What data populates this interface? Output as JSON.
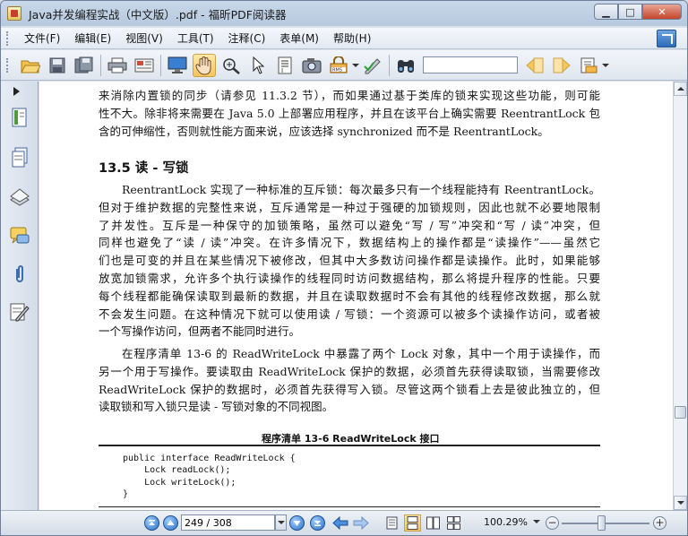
{
  "window": {
    "title": "Java并发编程实战（中文版）.pdf - 福昕PDF阅读器",
    "min_label": "▁",
    "max_label": "□",
    "close_label": "✕"
  },
  "menu": {
    "items": [
      "文件(F)",
      "编辑(E)",
      "视图(V)",
      "工具(T)",
      "注释(C)",
      "表单(M)",
      "帮助(H)"
    ]
  },
  "toolbar": {
    "search_value": "",
    "buttons": [
      "open",
      "save",
      "save-as",
      "print",
      "properties",
      "fullscreen",
      "hand-tool",
      "zoom-tool",
      "select-tool",
      "text-select",
      "snapshot",
      "rms",
      "sign",
      "find",
      "find-prev",
      "find-next",
      "comment-tools"
    ]
  },
  "document": {
    "para1": [
      "来消除内置锁的同步（请参见 11.3.2 节），而如果通过基于类库的锁来实现这些功能，则可能",
      "性不大。除非将来需要在 Java 5.0 上部署应用程序，并且在该平台上确实需要 ReentrantLock 包",
      "含的可伸缩性，否则就性能方面来说，应该选择 synchronized 而不是 ReentrantLock。"
    ],
    "section_title": "13.5   读 - 写锁",
    "para2": [
      "ReentrantLock 实现了一种标准的互斥锁：每次最多只有一个线程能持有 ReentrantLock。",
      "但对于维护数据的完整性来说，互斥通常是一种过于强硬的加锁规则，因此也就不必要地限制",
      "了并发性。互斥是一种保守的加锁策略，虽然可以避免“写 / 写”冲突和“写 / 读”冲突，但",
      "同样也避免了“读 / 读”冲突。在许多情况下，数据结构上的操作都是“读操作”——虽然它",
      "们也是可变的并且在某些情况下被修改，但其中大多数访问操作都是读操作。此时，如果能够",
      "放宽加锁需求，允许多个执行读操作的线程同时访问数据结构，那么将提升程序的性能。只要",
      "每个线程都能确保读取到最新的数据，并且在读取数据时不会有其他的线程修改数据，那么就",
      "不会发生问题。在这种情况下就可以使用读 / 写锁：一个资源可以被多个读操作访问，或者被",
      "一个写操作访问，但两者不能同时进行。"
    ],
    "para3": [
      "在程序清单 13-6 的 ReadWriteLock 中暴露了两个 Lock 对象，其中一个用于读操作，而",
      "另一个用于写操作。要读取由 ReadWriteLock 保护的数据，必须首先获得读取锁，当需要修改",
      "ReadWriteLock 保护的数据时，必须首先获得写入锁。尽管这两个锁看上去是彼此独立的，但",
      "读取锁和写入锁只是读 - 写锁对象的不同视图。"
    ],
    "listing_title": "程序清单 13-6    ReadWriteLock 接口",
    "code_lines": [
      "public interface ReadWriteLock {",
      "    Lock readLock();",
      "    Lock writeLock();",
      "}"
    ]
  },
  "status": {
    "page_value": "249 / 308",
    "zoom_value": "100.29%",
    "zoom_fraction": 0.45,
    "zoom_minus": "−",
    "zoom_plus": "+"
  },
  "colors": {
    "accent": "#2b6fc4",
    "active_tool": "#f6c45a",
    "close_button": "#c4452c"
  }
}
